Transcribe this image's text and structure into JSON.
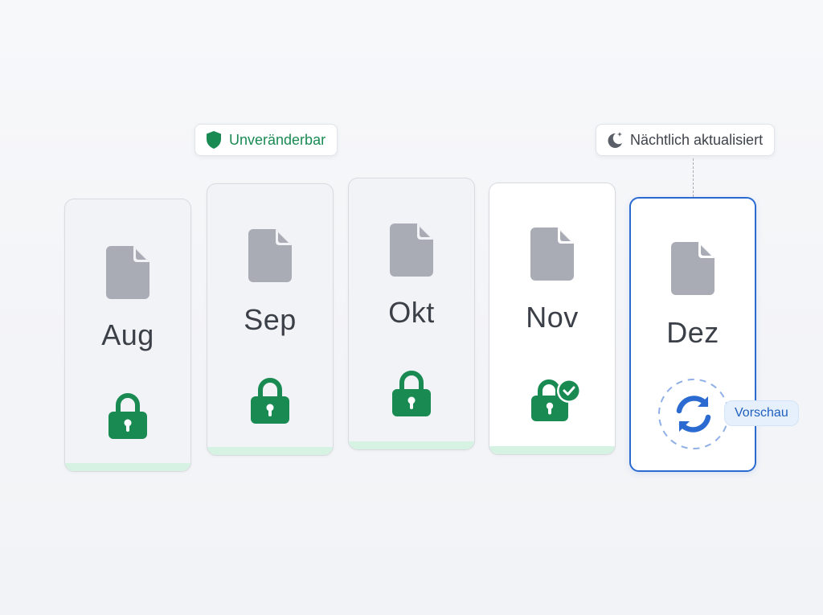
{
  "badges": {
    "immutable": "Unveränderbar",
    "nightly": "Nächtlich aktualisiert"
  },
  "months": [
    {
      "label": "Aug",
      "state": "locked"
    },
    {
      "label": "Sep",
      "state": "locked"
    },
    {
      "label": "Okt",
      "state": "locked"
    },
    {
      "label": "Nov",
      "state": "locked-verified"
    },
    {
      "label": "Dez",
      "state": "refreshing"
    }
  ],
  "preview_label": "Vorschau",
  "icons": {
    "immutable": "shield-icon",
    "nightly": "moon-sparkle-icon",
    "file": "file-icon",
    "lock": "lock-icon",
    "verified": "check-circle-icon",
    "refresh": "refresh-icon"
  },
  "colors": {
    "green": "#1a8a53",
    "file_gray": "#a9acb5",
    "blue": "#2b6bd1",
    "stripe": "#d6f2e2"
  }
}
